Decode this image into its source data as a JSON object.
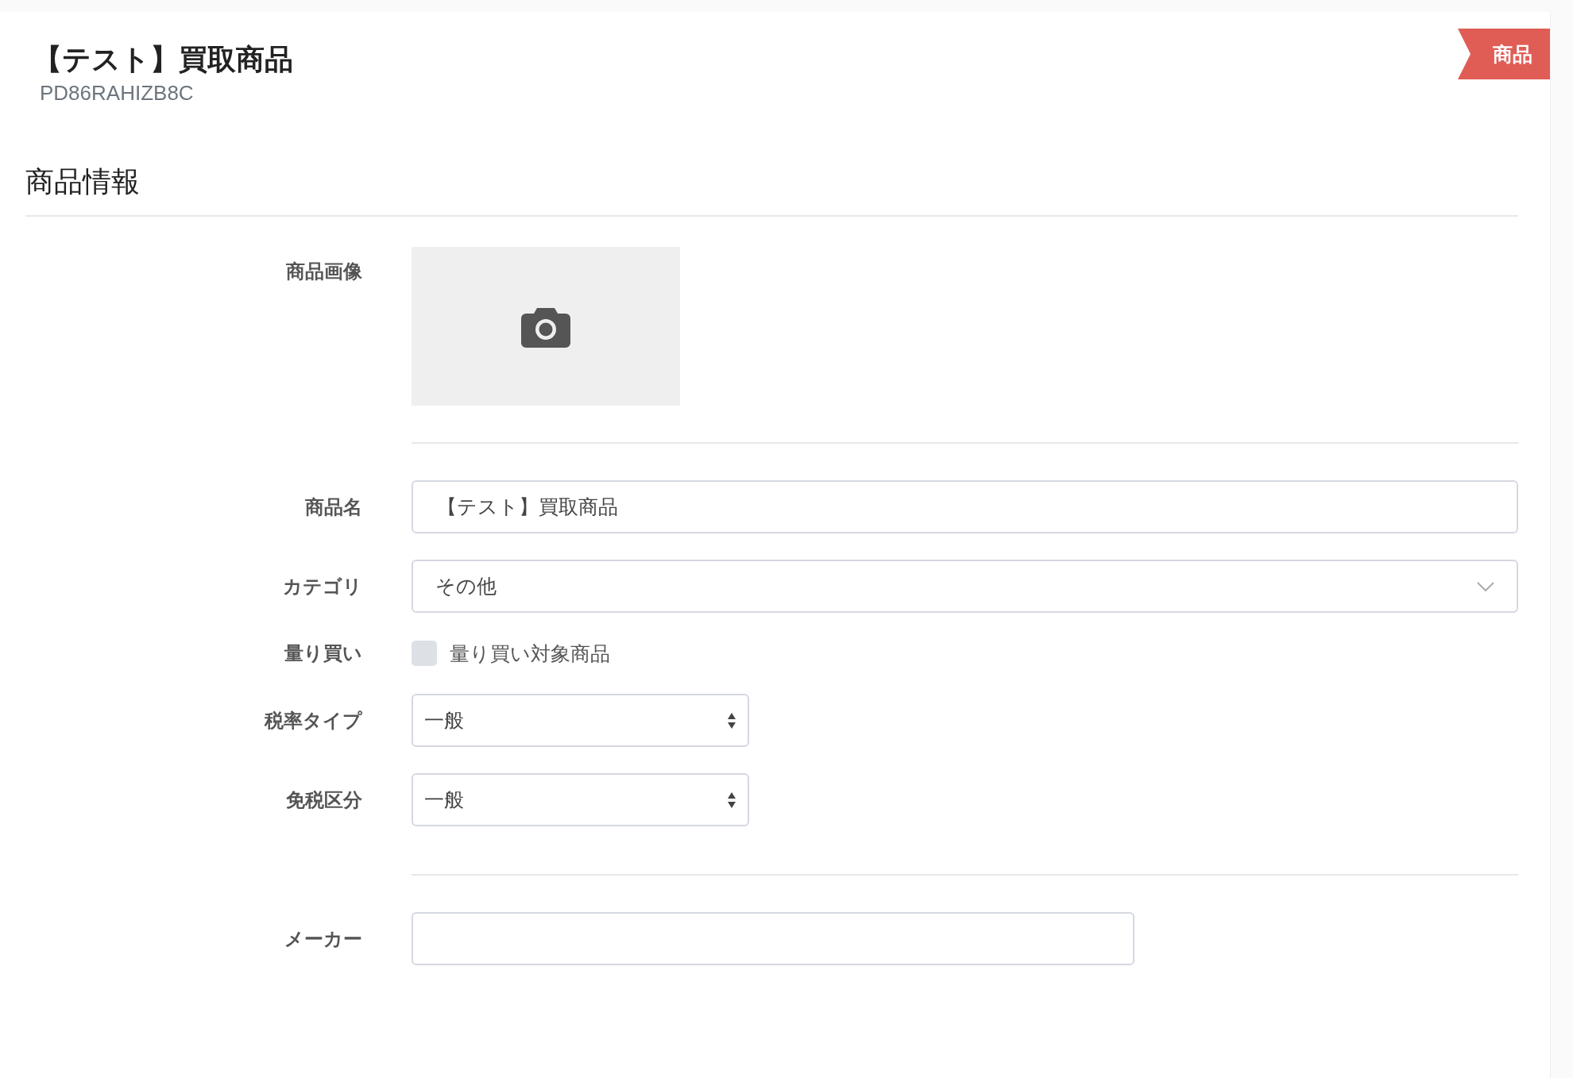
{
  "header": {
    "title": "【テスト】買取商品",
    "code": "PD86RAHIZB8C",
    "badge": "商品"
  },
  "section": {
    "title": "商品情報"
  },
  "fields": [
    {
      "kind": "image",
      "label": "商品画像"
    },
    {
      "kind": "divider"
    },
    {
      "kind": "text",
      "label": "商品名",
      "value": "【テスト】買取商品"
    },
    {
      "kind": "dropdown",
      "label": "カテゴリ",
      "value": "その他"
    },
    {
      "kind": "checkbox",
      "label": "量り買い",
      "text": "量り買い対象商品",
      "checked": false
    },
    {
      "kind": "spinner-select",
      "label": "税率タイプ",
      "value": "一般"
    },
    {
      "kind": "spinner-select",
      "label": "免税区分",
      "value": "一般"
    },
    {
      "kind": "divider"
    },
    {
      "kind": "short-text",
      "label": "メーカー"
    }
  ]
}
